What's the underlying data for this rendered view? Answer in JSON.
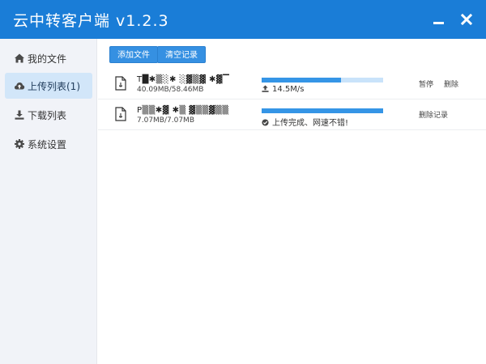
{
  "window": {
    "title": "云中转客户端 v1.2.3",
    "minimize_icon": "minimize-icon",
    "close_icon": "close-icon"
  },
  "sidebar": {
    "items": [
      {
        "label": "我的文件",
        "icon": "home-icon",
        "active": false
      },
      {
        "label": "上传列表(1)",
        "icon": "cloud-upload-icon",
        "active": true
      },
      {
        "label": "下载列表",
        "icon": "download-icon",
        "active": false
      },
      {
        "label": "系统设置",
        "icon": "gear-icon",
        "active": false
      }
    ]
  },
  "toolbar": {
    "add_label": "添加文件",
    "clear_label": "清空记录"
  },
  "uploads": [
    {
      "name": "T█✱▒░✱ ░▓▒▓ ✱▓▔",
      "size": "40.09MB/58.46MB",
      "progress": 0.65,
      "status": "14.5M/s",
      "status_icon": "upload-icon",
      "actions": [
        "暂停",
        "删除"
      ]
    },
    {
      "name": "P▒▒✱▓ ✱▒ ▓▒▒▓▒▒",
      "size": "7.07MB/7.07MB",
      "progress": 1.0,
      "status": "上传完成、网速不错!",
      "status_icon": "check-circle-icon",
      "actions": [
        "删除记录"
      ]
    }
  ],
  "colors": {
    "accent": "#1a7dd7",
    "button": "#3590e2",
    "progress_fill": "#3595e6",
    "progress_track": "#c9e3fa",
    "sidebar_bg": "#f1f3f8",
    "sidebar_active": "#d2e6f9"
  }
}
